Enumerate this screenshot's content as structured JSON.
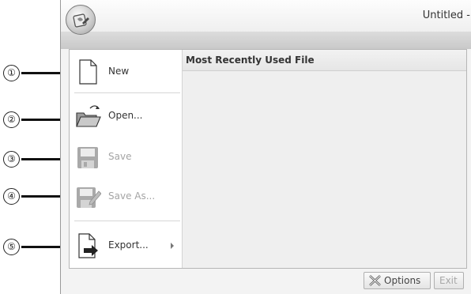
{
  "window": {
    "title": "Untitled -"
  },
  "callouts": [
    "①",
    "②",
    "③",
    "④",
    "⑤"
  ],
  "menu": {
    "items": [
      {
        "label": "New",
        "enabled": true,
        "icon": "new-document-icon"
      },
      {
        "label": "Open...",
        "enabled": true,
        "icon": "open-folder-icon"
      },
      {
        "label": "Save",
        "enabled": false,
        "icon": "save-icon"
      },
      {
        "label": "Save As...",
        "enabled": false,
        "icon": "save-as-icon"
      },
      {
        "label": "Export...",
        "enabled": true,
        "icon": "export-icon",
        "submenu": true
      }
    ]
  },
  "mru": {
    "header": "Most Recently Used File",
    "files": []
  },
  "footer": {
    "options_label": "Options",
    "exit_label": "Exit",
    "exit_enabled": false
  }
}
